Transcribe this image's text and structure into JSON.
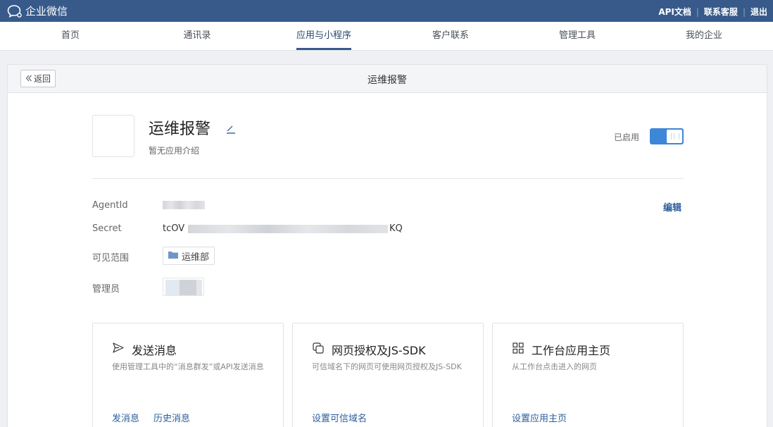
{
  "topbar": {
    "logo_text": "企业微信",
    "links": [
      "API文档",
      "联系客服",
      "退出"
    ]
  },
  "nav": {
    "items": [
      "首页",
      "通讯录",
      "应用与小程序",
      "客户联系",
      "管理工具",
      "我的企业"
    ],
    "active": "应用与小程序"
  },
  "panel": {
    "back_label": "返回",
    "title": "运维报警"
  },
  "app": {
    "name": "运维报警",
    "description": "暂无应用介绍",
    "status_label": "已启用",
    "enabled": true
  },
  "info": {
    "agentid_label": "AgentId",
    "secret_label": "Secret",
    "secret_prefix": "tcOV",
    "secret_suffix": "KQ",
    "scope_label": "可见范围",
    "scope_department": "运维部",
    "admin_label": "管理员",
    "edit_label": "编辑"
  },
  "cards": [
    {
      "icon": "send-icon",
      "title": "发送消息",
      "desc": "使用管理工具中的“消息群发”或API发送消息",
      "links": [
        "发消息",
        "历史消息"
      ]
    },
    {
      "icon": "copy-icon",
      "title": "网页授权及JS-SDK",
      "desc": "可信域名下的网页可使用网页授权及JS-SDK",
      "links": [
        "设置可信域名"
      ]
    },
    {
      "icon": "grid-icon",
      "title": "工作台应用主页",
      "desc": "从工作台点击进入的网页",
      "links": [
        "设置应用主页"
      ]
    }
  ]
}
